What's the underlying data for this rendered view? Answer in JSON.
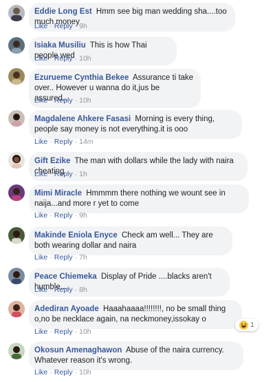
{
  "actions": {
    "like": "Like",
    "reply": "Reply",
    "separator": "·"
  },
  "reaction": {
    "emoji": "laugh-emoji",
    "count": "1"
  },
  "comments": [
    {
      "author": "Eddie Long Est",
      "text": "Hmm see big man wedding sha....too much money",
      "time": "9h"
    },
    {
      "author": "Isiaka Musiliu",
      "text": "This is how Thai people wed",
      "time": "10h"
    },
    {
      "author": "Ezurueme Cynthia Bekee",
      "text": "Assurance ti take over.. However u wanna do it,jus be assured..",
      "time": "10h"
    },
    {
      "author": "Magdalene Ahkere Fasasi",
      "text": "Morning is every thing, people say money is not everything.it is ooo",
      "time": "14m"
    },
    {
      "author": "Gift Ezike",
      "text": "The man with dollars while the lady with naira cheating",
      "time": "1h"
    },
    {
      "author": "Mimi Miracle",
      "text": "Hmmmm there nothing we wount see in naija...and more r yet to come",
      "time": "9h"
    },
    {
      "author": "Makinde Eniola Enyce",
      "text": "Check am well... They are both wearing dollar and naira",
      "time": "7h"
    },
    {
      "author": "Peace Chiemeka",
      "text": "Display of Pride ....blacks aren't humble....",
      "time": "8h"
    },
    {
      "author": "Adediran Ayoade",
      "text": "Haaahaaaa!!!!!!!!, no be small thing o,no be necklace again, na neckmoney,issokay o",
      "time": "10h"
    },
    {
      "author": "Okosun Amenaghawon",
      "text": "Abuse of the naira currency. Whatever reason it's wrong.",
      "time": "10h"
    }
  ]
}
